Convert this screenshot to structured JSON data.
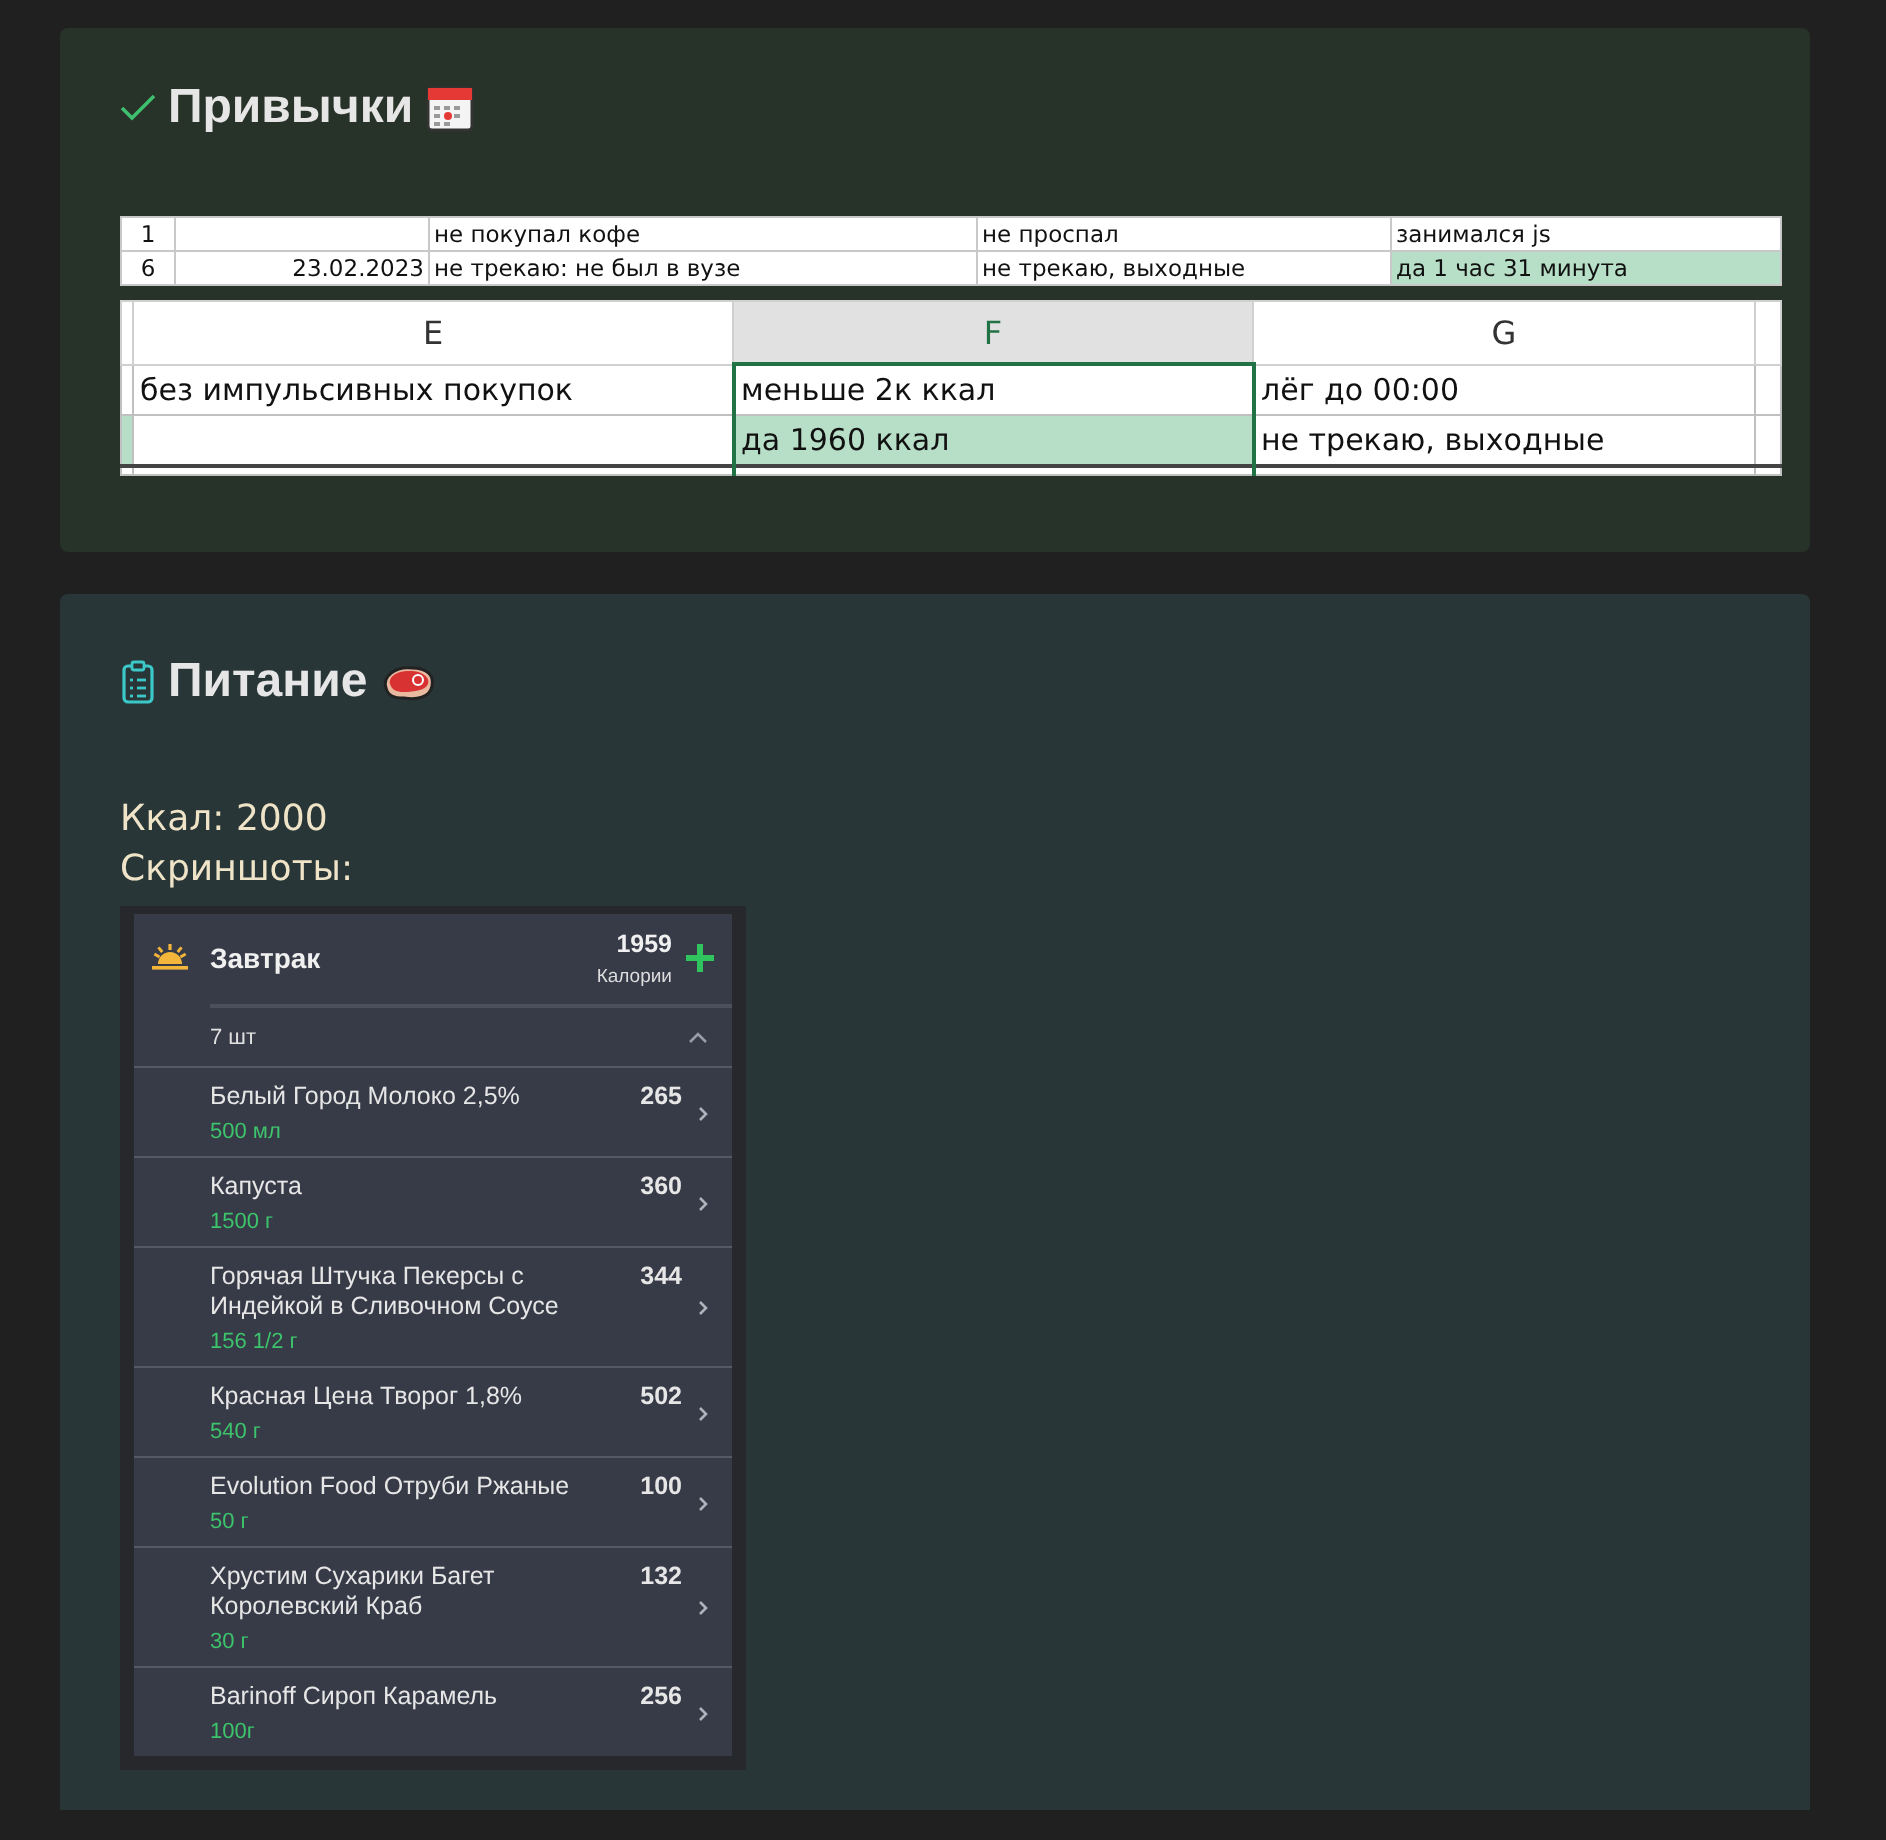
{
  "habits": {
    "title": "Привычки",
    "sheet_top": {
      "rows": [
        {
          "cells": [
            {
              "text": "1",
              "highlighted": false
            },
            {
              "text": "",
              "highlighted": false
            },
            {
              "text": "не покупал кофе",
              "highlighted": false
            },
            {
              "text": "не проспал",
              "highlighted": false
            },
            {
              "text": "занимался js",
              "highlighted": false
            }
          ]
        },
        {
          "cells": [
            {
              "text": "6",
              "highlighted": false
            },
            {
              "text": "23.02.2023",
              "highlighted": false
            },
            {
              "text": "не трекаю: не был в вузе",
              "highlighted": false
            },
            {
              "text": "не трекаю, выходные",
              "highlighted": false
            },
            {
              "text": "да 1 час 31 минута",
              "highlighted": true
            }
          ]
        }
      ]
    },
    "sheet_zoom": {
      "columns": [
        {
          "label": "E",
          "selected": false
        },
        {
          "label": "F",
          "selected": true
        },
        {
          "label": "G",
          "selected": false
        }
      ],
      "rows": [
        {
          "cells": [
            {
              "text": "без импульсивных покупок",
              "highlighted": false
            },
            {
              "text": "меньше 2к ккал",
              "highlighted": false
            },
            {
              "text": "лёг до 00:00",
              "highlighted": false
            }
          ]
        },
        {
          "cells": [
            {
              "text": "",
              "highlighted": false
            },
            {
              "text": "да 1960 ккал",
              "highlighted": true
            },
            {
              "text": "не трекаю, выходные",
              "highlighted": false
            }
          ]
        }
      ]
    }
  },
  "nutrition": {
    "title": "Питание",
    "kcal": "Ккал: 2000",
    "screenshots_label": "Скриншоты:",
    "meal": {
      "name": "Завтрак",
      "calories": "1959",
      "calories_label": "Калории",
      "count": "7 шт",
      "expanded": true,
      "items": [
        {
          "name": "Белый Город Молоко 2,5%",
          "amount": "500 мл",
          "kcal": "265"
        },
        {
          "name": "Капуста",
          "amount": "1500 г",
          "kcal": "360"
        },
        {
          "name": "Горячая Штучка Пекерсы с Индейкой в Сливочном Соусе",
          "amount": "156 1/2 г",
          "kcal": "344"
        },
        {
          "name": "Красная Цена Творог 1,8%",
          "amount": "540 г",
          "kcal": "502"
        },
        {
          "name": "Evolution Food Отруби Ржаные",
          "amount": "50 г",
          "kcal": "100"
        },
        {
          "name": "Хрустим Сухарики Багет Королевский Краб",
          "amount": "30 г",
          "kcal": "132"
        },
        {
          "name": "Barinoff Сироп Карамель",
          "amount": "100г",
          "kcal": "256"
        }
      ]
    }
  }
}
